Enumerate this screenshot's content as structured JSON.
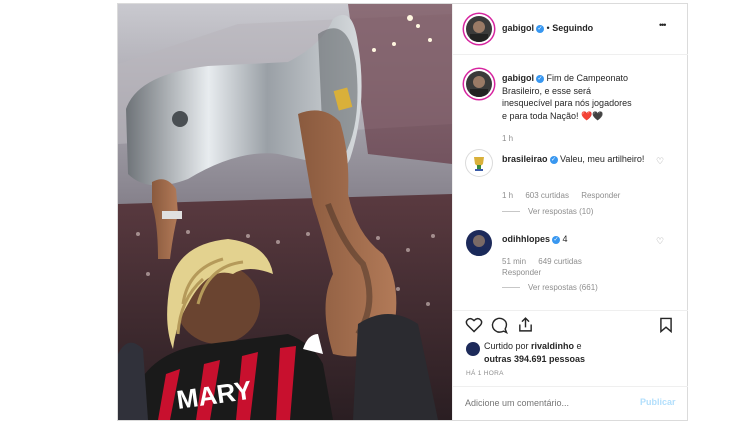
{
  "header": {
    "username": "gabigol",
    "separator": "•",
    "follow_status": "Seguindo",
    "more": "•••"
  },
  "caption": {
    "username": "gabigol",
    "text": "Fim de Campeonato Brasileiro, e esse será inesquecível para nós jogadores e para toda Nação! ❤️🖤",
    "time": "1 h"
  },
  "comments": [
    {
      "username": "brasileirao",
      "text": "Valeu, meu artilheiro!",
      "time": "1 h",
      "likes": "603 curtidas",
      "reply": "Responder",
      "view_replies": "Ver respostas (10)"
    },
    {
      "username": "odihhlopes",
      "text": "4",
      "time": "51 min",
      "likes": "649 curtidas",
      "reply": "Responder",
      "view_replies": "Ver respostas (661)"
    }
  ],
  "likes": {
    "prefix": "Curtido por ",
    "user": "rivaldinho",
    "suffix": " e",
    "others": "outras 394.691 pessoas"
  },
  "timestamp": "HÁ 1 HORA",
  "comment_input": {
    "placeholder": "Adicione um comentário...",
    "publish": "Publicar"
  },
  "jersey_text": "MARY",
  "colors": {
    "verified": "#3897f0",
    "publish_disabled": "#b2dffc",
    "jersey_red": "#c8102e"
  }
}
